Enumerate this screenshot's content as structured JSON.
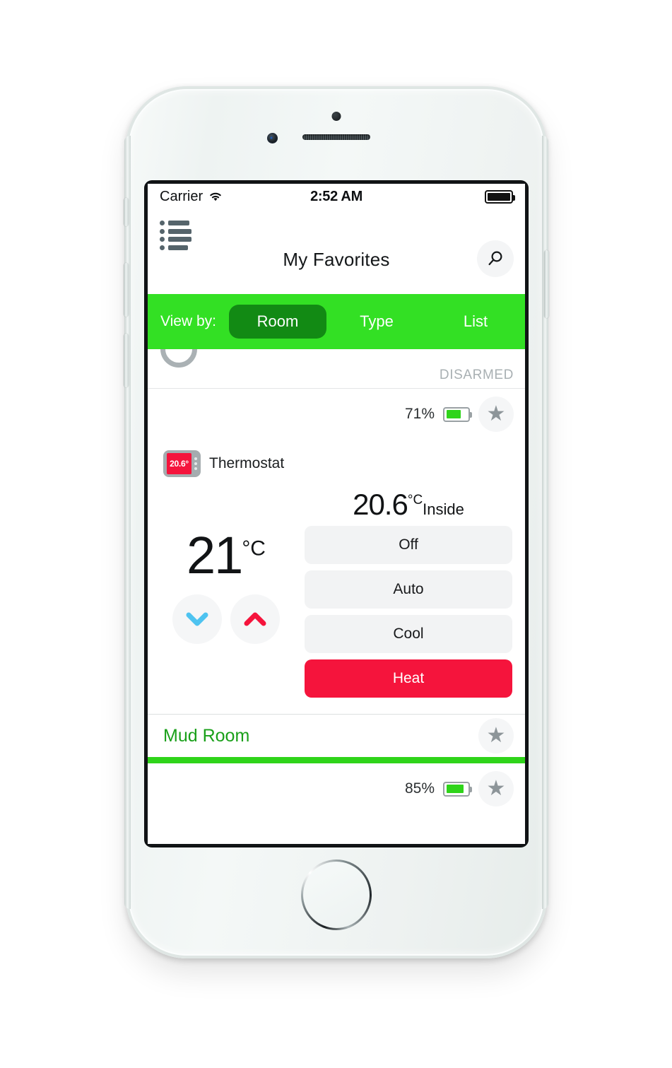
{
  "status_bar": {
    "carrier": "Carrier",
    "wifi_icon": "wifi-icon",
    "time": "2:52 AM",
    "battery_icon": "battery-full-icon"
  },
  "navbar": {
    "menu_icon": "list-menu-icon",
    "title": "My Favorites",
    "search_icon": "search-icon"
  },
  "view_bar": {
    "label": "View by:",
    "tabs": [
      {
        "label": "Room",
        "active": true
      },
      {
        "label": "Type",
        "active": false
      },
      {
        "label": "List",
        "active": false
      }
    ],
    "bar_color": "#33E024",
    "active_color": "#128A14"
  },
  "security_row": {
    "status": "DISARMED"
  },
  "battery_row_top": {
    "percent": "71%",
    "star_icon": "star-icon"
  },
  "thermostat": {
    "icon_label": "20.6°",
    "name": "Thermostat",
    "setpoint_value": "21",
    "setpoint_unit": "°C",
    "inside_value": "20.6",
    "inside_unit": "°C",
    "inside_label": "Inside",
    "decrease_icon": "chevron-down-icon",
    "increase_icon": "chevron-up-icon",
    "decrease_color": "#4EC3F0",
    "increase_color": "#F5143C",
    "modes": [
      {
        "label": "Off",
        "active": false
      },
      {
        "label": "Auto",
        "active": false
      },
      {
        "label": "Cool",
        "active": false
      },
      {
        "label": "Heat",
        "active": true
      }
    ],
    "active_mode_color": "#F5143C"
  },
  "room_row": {
    "name": "Mud Room",
    "star_icon": "star-icon",
    "divider_color": "#2FD41A"
  },
  "battery_row_bottom": {
    "percent": "85%",
    "star_icon": "star-icon"
  }
}
